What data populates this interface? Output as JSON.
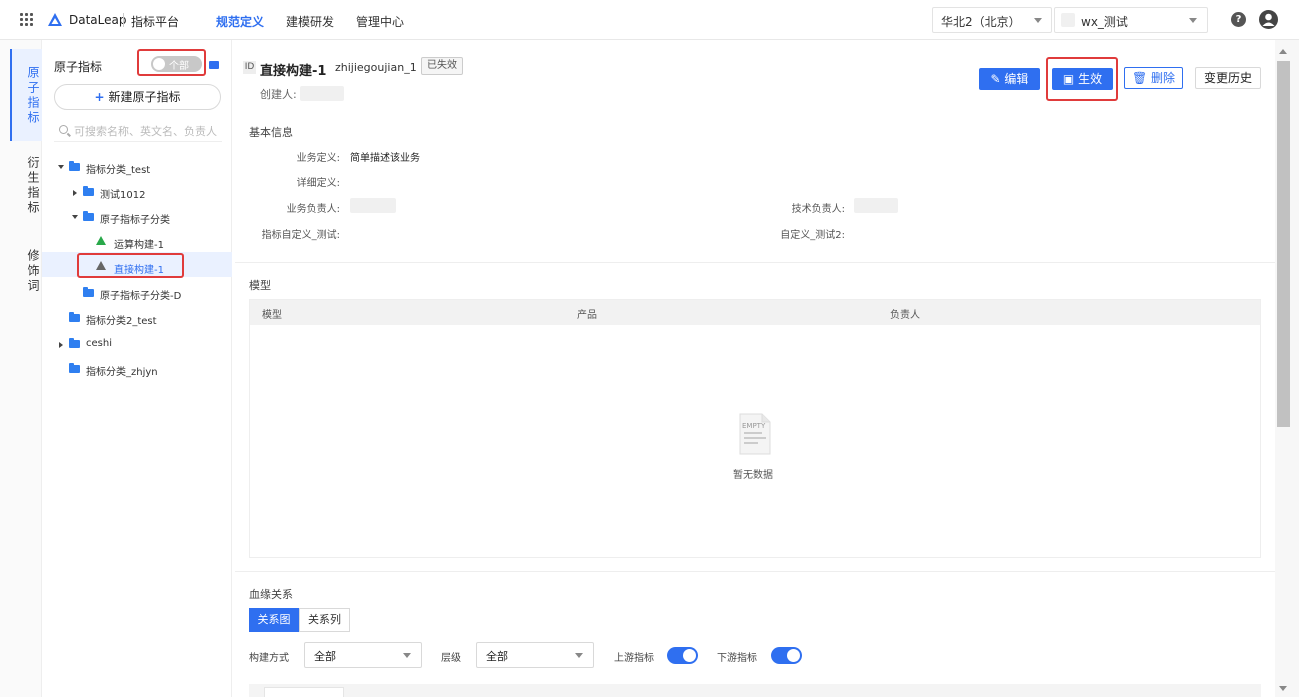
{
  "topbar": {
    "brand": "DataLeap",
    "platform": "指标平台",
    "nav": [
      "规范定义",
      "建模研发",
      "管理中心"
    ],
    "region": "华北2（北京）",
    "project": "wx_测试"
  },
  "leftnav": {
    "tabs": [
      "原子指标",
      "衍生指标",
      "修饰词"
    ]
  },
  "tree": {
    "title": "原子指标",
    "toggle_label": "个部",
    "new_button": "新建原子指标",
    "search_placeholder": "可搜索名称、英文名、负责人",
    "items": [
      {
        "label": "指标分类_test"
      },
      {
        "label": "测试1012"
      },
      {
        "label": "原子指标子分类"
      },
      {
        "label": "运算构建-1"
      },
      {
        "label": "直接构建-1"
      },
      {
        "label": "原子指标子分类-D"
      },
      {
        "label": "指标分类2_test"
      },
      {
        "label": "ceshi"
      },
      {
        "label": "指标分类_zhjyn"
      }
    ]
  },
  "detail": {
    "id_tag": "ID",
    "title": "直接构建-1",
    "code": "zhijiegoujian_1",
    "status": "已失效",
    "creator_label": "创建人:",
    "buttons": {
      "edit": "编辑",
      "activate": "生效",
      "delete": "删除",
      "history": "变更历史"
    },
    "basic_title": "基本信息",
    "fields": {
      "business_def_label": "业务定义:",
      "business_def_value": "简单描述该业务",
      "detail_def_label": "详细定义:",
      "biz_owner_label": "业务负责人:",
      "tech_owner_label": "技术负责人:",
      "custom1_label": "指标自定义_测试:",
      "custom2_label": "自定义_测试2:"
    },
    "model_section": {
      "title": "模型",
      "columns": [
        "模型",
        "产品",
        "负责人"
      ],
      "empty_icon_text": "EMPTY",
      "empty_text": "暂无数据"
    },
    "lineage": {
      "title": "血缘关系",
      "tabs": [
        "关系图",
        "关系列"
      ],
      "build_label": "构建方式",
      "build_value": "全部",
      "level_label": "层级",
      "level_value": "全部",
      "upstream_label": "上游指标",
      "downstream_label": "下游指标"
    }
  },
  "colors": {
    "accent": "#2f6ff0",
    "highlight": "#e03b3b",
    "green": "#29a84a"
  }
}
